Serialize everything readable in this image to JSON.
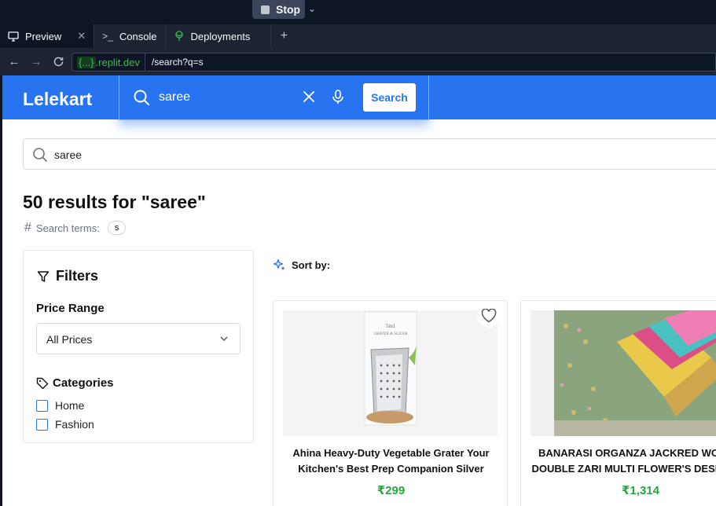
{
  "ide": {
    "stop_label": "Stop",
    "tabs": [
      {
        "label": "Preview",
        "icon": "monitor-icon"
      },
      {
        "label": "Console",
        "icon": "terminal-icon"
      },
      {
        "label": "Deployments",
        "icon": "deploy-icon"
      }
    ],
    "url_host_badge": "{...}",
    "url_host": ".replit.dev",
    "url_path": "/search?q=s"
  },
  "site": {
    "logo": "Lelekart",
    "search_value": "saree",
    "search_button": "Search",
    "brand_color": "#2874f0"
  },
  "results": {
    "search_value": "saree",
    "title": "50 results for \"saree\"",
    "terms_label": "Search terms:",
    "term_chip": "s"
  },
  "filters": {
    "title": "Filters",
    "price_range_label": "Price Range",
    "price_selected": "All Prices",
    "categories_label": "Categories",
    "categories": [
      "Home",
      "Fashion"
    ]
  },
  "sort": {
    "label": "Sort by:"
  },
  "products": [
    {
      "name_line1": "Ahina Heavy-Duty Vegetable Grater Your",
      "name_line2": "Kitchen's Best Prep Companion Silver",
      "price": "₹299",
      "image_text": "5in1 GRATER & SLICER"
    },
    {
      "name_line1": "BANARASI ORGANZA JACKRED WO",
      "name_line2": "DOUBLE ZARI MULTI FLOWER'S DESIG",
      "price": "₹1,314"
    }
  ]
}
